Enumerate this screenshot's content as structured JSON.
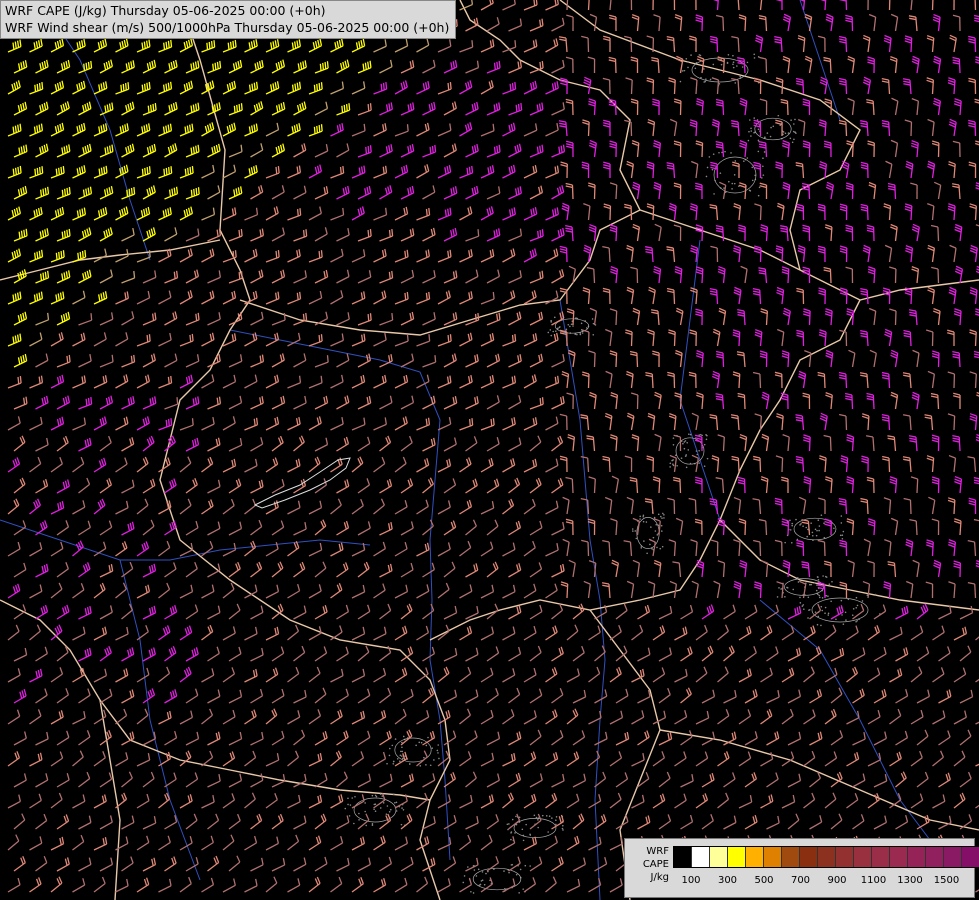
{
  "title": {
    "line1": "WRF CAPE (J/kg) Thursday 05-06-2025 00:00 (+0h)",
    "line2": "WRF Wind shear (m/s) 500/1000hPa Thursday 05-06-2025 00:00 (+0h)"
  },
  "legend": {
    "label_lines": [
      "WRF",
      "CAPE",
      "J/kg"
    ],
    "colors": [
      "#000000",
      "#ffffff",
      "#ffff99",
      "#ffff00",
      "#ffb000",
      "#e08000",
      "#a04a10",
      "#8a3010",
      "#8c3020",
      "#933030",
      "#983040",
      "#9a2e48",
      "#9a2a50",
      "#962358",
      "#90205e",
      "#8a1a64",
      "#840e68"
    ],
    "tick_labels": [
      "100",
      "300",
      "500",
      "700",
      "900",
      "1100",
      "1300",
      "1500"
    ]
  },
  "wind_colors": {
    "calm": "#b07070",
    "moderate": "#e08878",
    "strong": "#e020e0",
    "very_strong": "#ffff00",
    "mixed": "#c0a070"
  },
  "map_colors": {
    "background": "#000000",
    "borders": "#e8c8a8",
    "rivers": "#3050c0",
    "cape_hatch": "#888888"
  }
}
